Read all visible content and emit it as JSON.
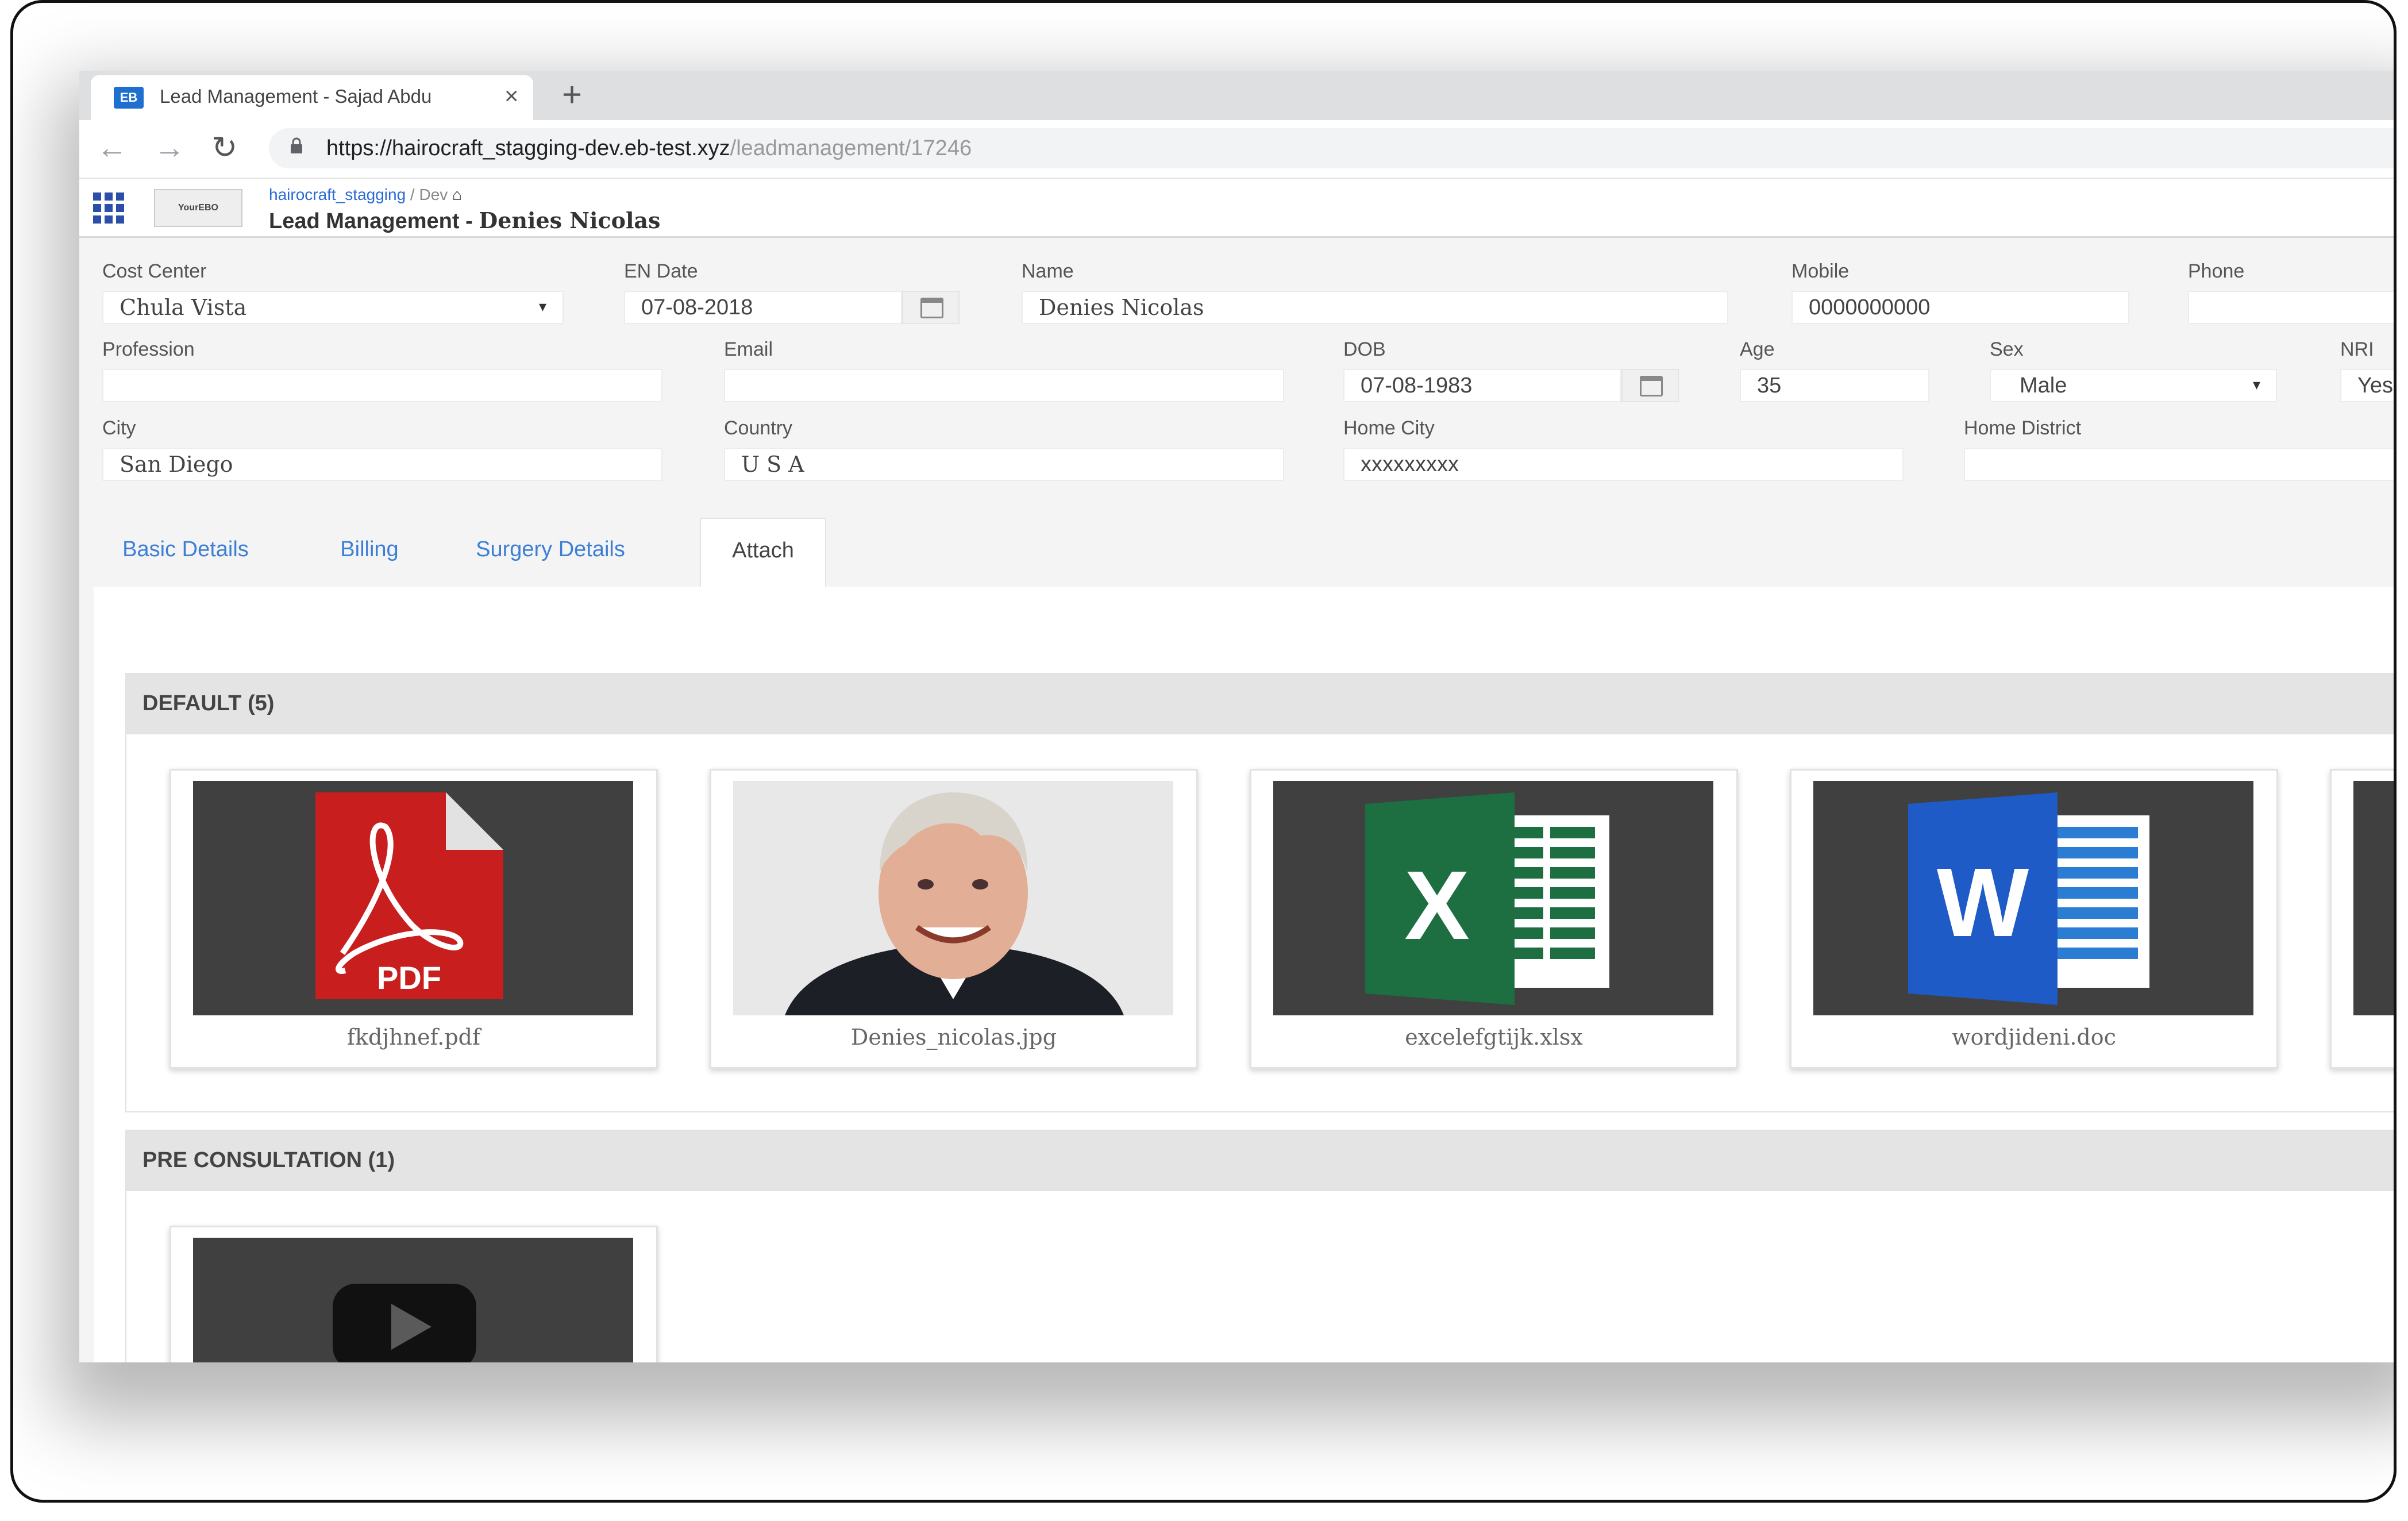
{
  "browser": {
    "tab_title": "Lead Management - Sajad Abdu",
    "tab_favicon_text": "EB",
    "close_glyph": "×",
    "new_tab_glyph": "+",
    "back_glyph": "←",
    "forward_glyph": "→",
    "reload_glyph": "↻",
    "url_host": "https://hairocraft_stagging-dev.eb-test.xyz",
    "url_path": "/leadmanagement/17246"
  },
  "app": {
    "logo_text": "YourEBO",
    "breadcrumb_solution": "hairocraft_stagging",
    "breadcrumb_sep": " / ",
    "breadcrumb_env": "Dev",
    "home_glyph": "⌂",
    "title_prefix": "Lead Management - ",
    "title_name": "Denies Nicolas"
  },
  "form": {
    "cost_center": {
      "label": "Cost Center",
      "value": "Chula Vista"
    },
    "en_date": {
      "label": "EN Date",
      "value": "07-08-2018"
    },
    "name": {
      "label": "Name",
      "value": "Denies Nicolas"
    },
    "mobile": {
      "label": "Mobile",
      "value": "0000000000"
    },
    "phone": {
      "label": "Phone",
      "value": ""
    },
    "profession": {
      "label": "Profession",
      "value": ""
    },
    "email": {
      "label": "Email",
      "value": ""
    },
    "dob": {
      "label": "DOB",
      "value": "07-08-1983"
    },
    "age": {
      "label": "Age",
      "value": "35"
    },
    "sex": {
      "label": "Sex",
      "value": "Male"
    },
    "nri": {
      "label": "NRI",
      "value": "Yes"
    },
    "city": {
      "label": "City",
      "value": "San Diego"
    },
    "country": {
      "label": "Country",
      "value": "U S A"
    },
    "home_city": {
      "label": "Home City",
      "value": "xxxxxxxxx"
    },
    "home_district": {
      "label": "Home District",
      "value": ""
    },
    "caret_glyph": "▾"
  },
  "tabs": [
    {
      "label": "Basic Details"
    },
    {
      "label": "Billing"
    },
    {
      "label": "Surgery Details"
    },
    {
      "label": "Attach"
    }
  ],
  "attachments": {
    "default_title": "DEFAULT (5)",
    "pre_title": "PRE CONSULTATION (1)",
    "files": [
      {
        "name": "fkdjhnef.pdf",
        "icon": "pdf-icon",
        "badge": "PDF"
      },
      {
        "name": "Denies_nicolas.jpg",
        "icon": "photo-thumbnail"
      },
      {
        "name": "excelefgtijk.xlsx",
        "icon": "excel-icon",
        "badge": "X"
      },
      {
        "name": "wordjideni.doc",
        "icon": "word-icon",
        "badge": "W"
      }
    ]
  },
  "colors": {
    "link_blue": "#3d7fd6",
    "pdf_red": "#c81e1e",
    "excel_green": "#1d6f42",
    "word_blue": "#1e5bc6"
  }
}
